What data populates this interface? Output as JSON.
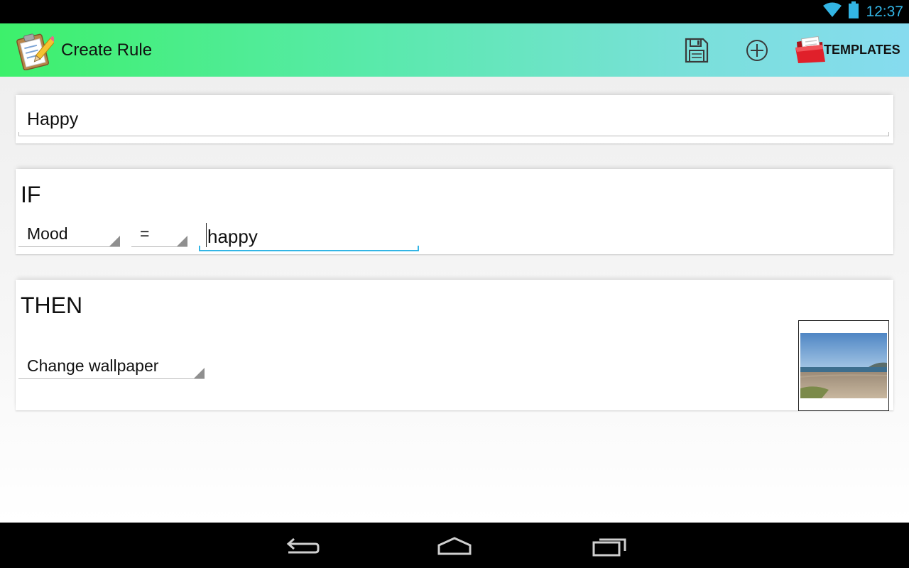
{
  "status_bar": {
    "time": "12:37",
    "icons": [
      "wifi-icon",
      "battery-icon"
    ]
  },
  "action_bar": {
    "title": "Create Rule",
    "app_icon": "clipboard-pencil-icon",
    "actions": {
      "save_icon": "floppy-disk-icon",
      "add_icon": "add-circle-icon",
      "templates_label": "TEMPLATES",
      "templates_icon": "red-folder-icon"
    },
    "gradient_colors": [
      "#3df06b",
      "#86dbef"
    ]
  },
  "rule": {
    "name_value": "Happy"
  },
  "if_section": {
    "heading": "IF",
    "field_selected": "Mood",
    "operator_selected": "=",
    "value_input": "happy"
  },
  "then_section": {
    "heading": "THEN",
    "action_selected": "Change wallpaper",
    "preview_icon": "beach-wallpaper-thumbnail"
  },
  "nav_bar": {
    "buttons": [
      "back-icon",
      "home-icon",
      "recent-apps-icon"
    ]
  },
  "colors": {
    "accent": "#33b5e5",
    "text": "#111111"
  }
}
